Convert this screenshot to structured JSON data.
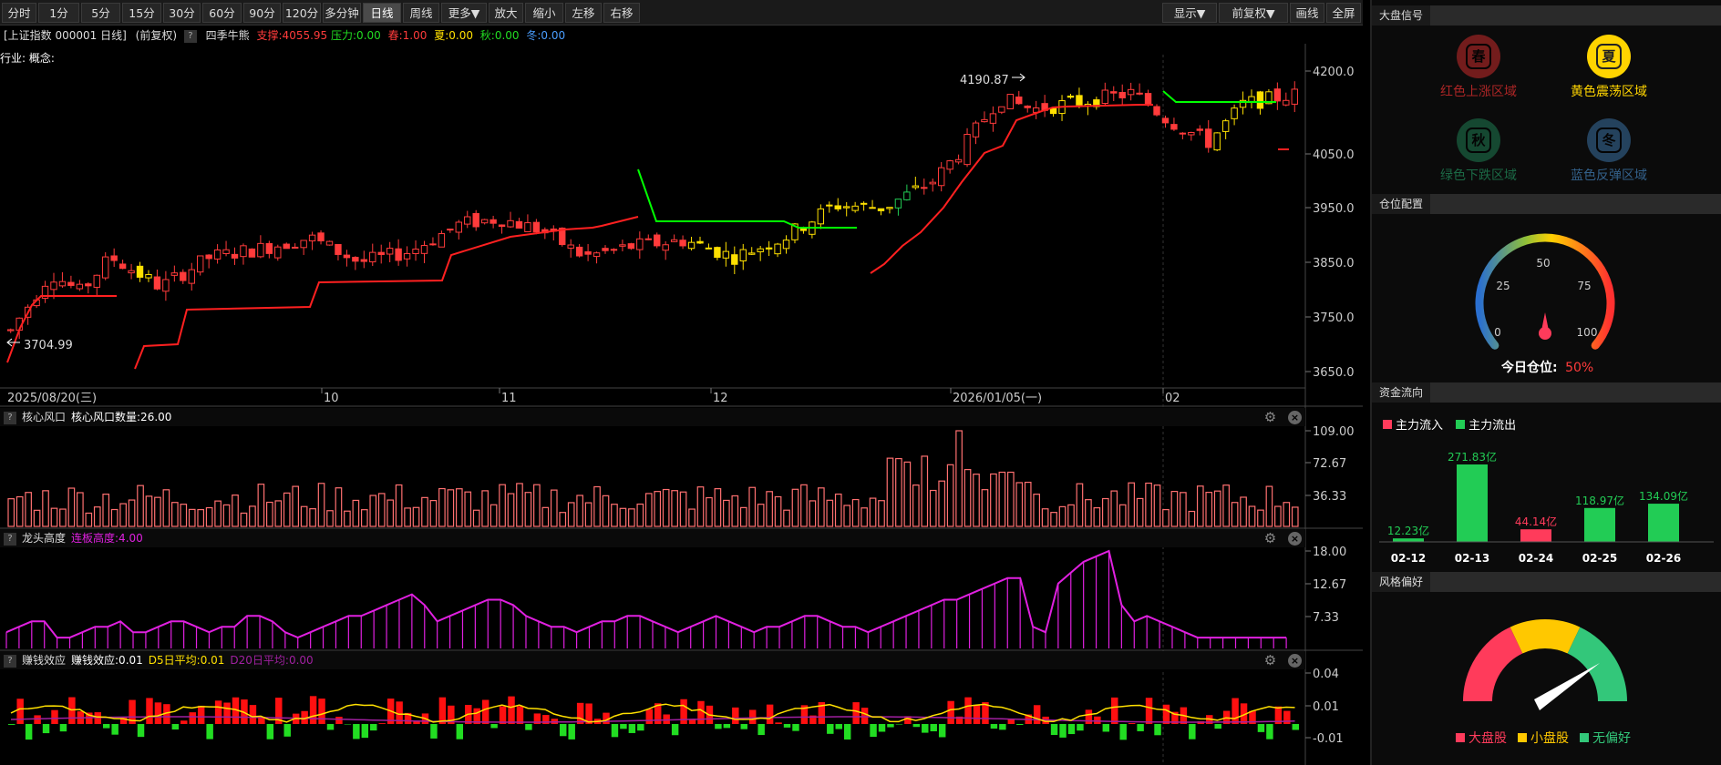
{
  "toolbar": {
    "left_buttons": [
      "分时",
      "1分",
      "5分",
      "15分",
      "30分",
      "60分",
      "90分",
      "120分",
      "多分钟",
      "日线",
      "周线",
      "更多▼",
      "放大",
      "缩小",
      "左移",
      "右移"
    ],
    "active_index": 9,
    "right_buttons": [
      "显示▼",
      "前复权▼",
      "画线",
      "全屏"
    ]
  },
  "info_bar": {
    "title": "[上证指数 000001 日线]",
    "adjust": "(前复权)",
    "help": "?",
    "indicator_name": "四季牛熊",
    "support": "支撑:4055.95",
    "pressure": "压力:0.00",
    "spring": "春:1.00",
    "summer": "夏:0.00",
    "autumn": "秋:0.00",
    "winter": "冬:0.00",
    "industry": "行业: 概念:"
  },
  "colors": {
    "up": "#ff3b3b",
    "down": "#22cc55",
    "yellow": "#ffe000",
    "magenta": "#e020e0",
    "green_line": "#00ff00",
    "red_line": "#ff2020"
  },
  "main_chart": {
    "y_ticks": [
      "4200.0",
      "4050.0",
      "3950.0",
      "3850.0",
      "3750.0",
      "3650.0"
    ],
    "y_values": [
      4200,
      4050,
      3950,
      3850,
      3750,
      3650
    ],
    "x_labels": [
      "2025/08/20(三)",
      "10",
      "11",
      "12",
      "2026/01/05(一)",
      "02"
    ],
    "high_label": "4190.87",
    "low_label": "3704.99"
  },
  "chart_data": [
    {
      "type": "candlestick",
      "title": "上证指数 000001 日线",
      "ylim": [
        3640,
        4230
      ],
      "annotations": [
        "4190.87",
        "3704.99"
      ],
      "series_overview": {
        "start": "2025/08/20",
        "low": 3704.99,
        "high": 4190.87,
        "last_support": 4055.95
      }
    },
    {
      "type": "bar",
      "title": "核心风口",
      "series": [
        {
          "name": "核心风口数量",
          "last_value": 26.0
        }
      ],
      "y_ticks": [
        109.0,
        72.67,
        36.33
      ]
    },
    {
      "type": "area",
      "title": "龙头高度",
      "series": [
        {
          "name": "连板高度",
          "last_value": 4.0
        }
      ],
      "y_ticks": [
        18.0,
        12.67,
        7.33
      ]
    },
    {
      "type": "bar",
      "title": "赚钱效应",
      "series": [
        {
          "name": "赚钱效应",
          "last_value": 0.01
        },
        {
          "name": "D5日平均",
          "last_value": 0.01
        },
        {
          "name": "D20日平均",
          "last_value": 0.0
        }
      ],
      "y_ticks": [
        0.04,
        0.01,
        -0.01
      ]
    }
  ],
  "panels": [
    {
      "name": "核心风口",
      "label": "核心风口数量:26.00",
      "ticks": [
        "109.00",
        "72.67",
        "36.33"
      ]
    },
    {
      "name": "龙头高度",
      "label": "连板高度:4.00",
      "ticks": [
        "18.00",
        "12.67",
        "7.33"
      ]
    },
    {
      "name": "赚钱效应",
      "label1": "赚钱效应:0.01",
      "label2": "D5日平均:0.01",
      "label3": "D20日平均:0.00",
      "ticks": [
        "0.04",
        "0.01",
        "-0.01"
      ]
    }
  ],
  "right": {
    "signal_title": "大盘信号",
    "signals": [
      {
        "char": "春",
        "label": "红色上涨区域",
        "color": "#c82a2a",
        "active": false
      },
      {
        "char": "夏",
        "label": "黄色震荡区域",
        "color": "#ffd400",
        "active": true
      },
      {
        "char": "秋",
        "label": "绿色下跌区域",
        "color": "#1e7a50",
        "active": false
      },
      {
        "char": "冬",
        "label": "蓝色反弹区域",
        "color": "#3a6fa0",
        "active": false
      }
    ],
    "position_title": "仓位配置",
    "gauge": {
      "ticks": [
        "0",
        "25",
        "50",
        "75",
        "100"
      ],
      "label": "今日仓位:",
      "value": "50%",
      "value_num": 50
    },
    "flow_title": "资金流向",
    "flow_legend_in": "主力流入",
    "flow_legend_out": "主力流出",
    "flow": [
      {
        "date": "02-12",
        "value": "12.23亿",
        "num": 12.23,
        "dir": "out"
      },
      {
        "date": "02-13",
        "value": "271.83亿",
        "num": 271.83,
        "dir": "out"
      },
      {
        "date": "02-24",
        "value": "44.14亿",
        "num": 44.14,
        "dir": "in"
      },
      {
        "date": "02-25",
        "value": "118.97亿",
        "num": 118.97,
        "dir": "out"
      },
      {
        "date": "02-26",
        "value": "134.09亿",
        "num": 134.09,
        "dir": "out"
      }
    ],
    "style_title": "风格偏好",
    "style_legend": [
      "大盘股",
      "小盘股",
      "无偏好"
    ]
  }
}
